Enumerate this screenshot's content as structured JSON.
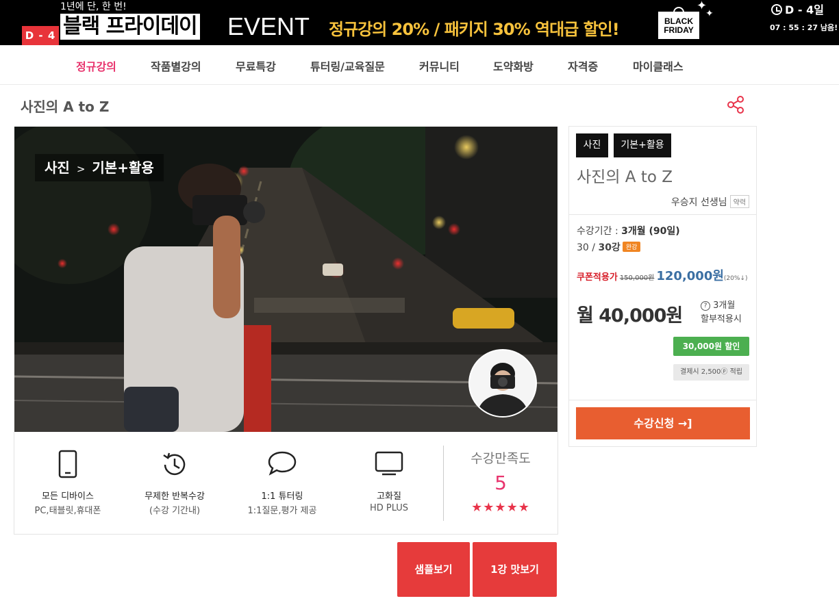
{
  "banner": {
    "d_badge": "D - 4",
    "once_text": "1년에 단, 한 번!",
    "black_friday_text": "블랙 프라이데이",
    "event_text": "EVENT",
    "promo_text": "정규강의 20% / 패키지 30% 역대급 할인!",
    "black_friday_logo": "BLACK FRIDAY",
    "countdown_days": "D - 4일",
    "countdown_timer": "07 : 55 : 27 남음!"
  },
  "nav": {
    "items": [
      "정규강의",
      "작품별강의",
      "무료특강",
      "튜터링/교육질문",
      "커뮤니티",
      "도약화방",
      "자격증",
      "마이클래스"
    ],
    "active_index": 0
  },
  "course": {
    "title": "사진의 A to Z",
    "breadcrumb": {
      "category": "사진",
      "separator": ">",
      "sub": "기본+활용"
    }
  },
  "features": [
    {
      "icon": "smartphone-icon",
      "title": "모든 디바이스",
      "desc": "PC,태블릿,휴대폰"
    },
    {
      "icon": "history-icon",
      "title": "무제한 반복수강",
      "desc": "(수강 기간내)"
    },
    {
      "icon": "chat-bubble-icon",
      "title": "1:1 튜터링",
      "desc": "1:1질문,평가 제공"
    },
    {
      "icon": "monitor-icon",
      "title": "고화질",
      "desc": "HD PLUS"
    }
  ],
  "satisfaction": {
    "label": "수강만족도",
    "score": "5",
    "stars": "★★★★★",
    "rating_value": 5,
    "rating_max": 5
  },
  "buttons": {
    "sample": "샘플보기",
    "trial": "1강 맛보기"
  },
  "panel": {
    "tags": [
      "사진",
      "기본+활용"
    ],
    "title": "사진의 A to Z",
    "teacher": "우승지 선생님",
    "teacher_bio": "약력",
    "period_label": "수강기간 : ",
    "period_value": "3개월 (90일)",
    "lessons_done": "30",
    "lessons_sep": " / ",
    "lessons_total": "30강",
    "lessons_badge": "완강",
    "coupon_label": "쿠폰적용가",
    "original_price": "150,000원",
    "final_price": "120,000원",
    "discount_rate": "(20%↓)",
    "monthly_price": "월 40,000원",
    "installment_q": "?",
    "installment_line1": "3개월",
    "installment_line2": "할부적용시",
    "discount_badge": "30,000원 할인",
    "points_badge": "결제시 2,500ⓟ 적립",
    "enroll_button": "수강신청 →]"
  },
  "colors": {
    "accent_pink": "#e8336d",
    "red_button": "#e63b3b",
    "enroll_orange": "#e85e30",
    "discount_green": "#4caf50",
    "banner_yellow": "#f7c23c",
    "price_blue": "#3b6fa3"
  }
}
